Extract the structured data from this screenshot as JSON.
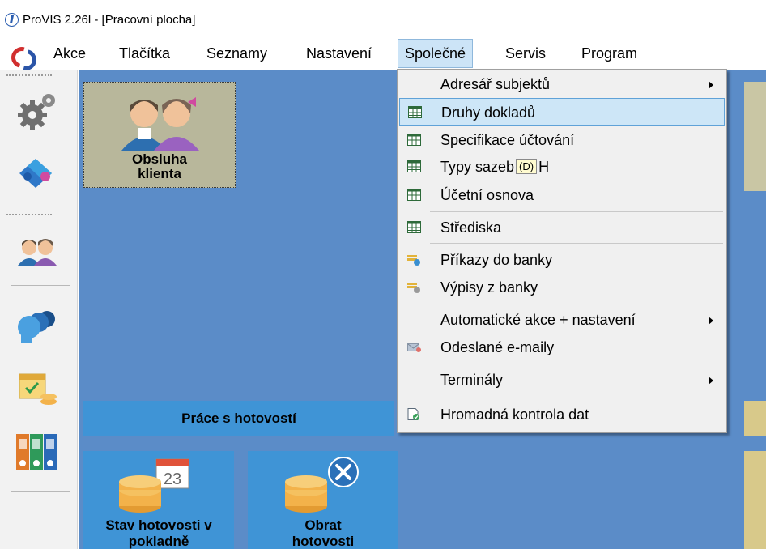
{
  "window": {
    "title": "ProVIS 2.26l - [Pracovní plocha]"
  },
  "menubar": {
    "items": [
      "Akce",
      "Tlačítka",
      "Seznamy",
      "Nastavení",
      "Společné",
      "Servis",
      "Program"
    ],
    "active": "Společné"
  },
  "dropdown": {
    "items": [
      {
        "label": "Adresář subjektů",
        "icon": "none",
        "submenu": true
      },
      {
        "label": "Druhy dokladů",
        "icon": "table-icon",
        "hover": true
      },
      {
        "label": "Specifikace účtování",
        "icon": "table-icon"
      },
      {
        "label_before": "Typy sazeb",
        "tip": "(D)",
        "label_after": "H",
        "icon": "table-icon"
      },
      {
        "label": "Účetní osnova",
        "icon": "table-icon"
      },
      {
        "label": "Střediska",
        "icon": "table-icon"
      },
      {
        "label": "Příkazy do banky",
        "icon": "bank-order-icon"
      },
      {
        "label": "Výpisy z banky",
        "icon": "bank-statement-icon"
      },
      {
        "label": "Automatické akce + nastavení",
        "icon": "none",
        "submenu": true
      },
      {
        "label": "Odeslané e-maily",
        "icon": "envelope-icon"
      },
      {
        "label": "Terminály",
        "icon": "none",
        "submenu": true
      },
      {
        "label": "Hromadná kontrola dat",
        "icon": "data-check-icon"
      }
    ]
  },
  "toolbar": {
    "buttons": [
      "gears-icon",
      "puzzle-icon",
      "people-icon",
      "group-heads-icon",
      "calendar-coins-icon",
      "binders-icon"
    ]
  },
  "workspace": {
    "client_tile": {
      "label_line1": "Obsluha",
      "label_line2": "klienta"
    },
    "cash_section": {
      "header": "Práce s hotovostí"
    },
    "cash_tiles": [
      {
        "line1": "Stav hotovosti v",
        "line2": "pokladně",
        "badge": "23"
      },
      {
        "line1": "Obrat",
        "line2": "hotovosti"
      }
    ]
  },
  "colors": {
    "workspace": "#5b8cc8",
    "tile_blue": "#3f94d6",
    "client_tile": "#b8b79b",
    "menu_highlight": "#cde6f7",
    "coin": "#f3b24a"
  }
}
